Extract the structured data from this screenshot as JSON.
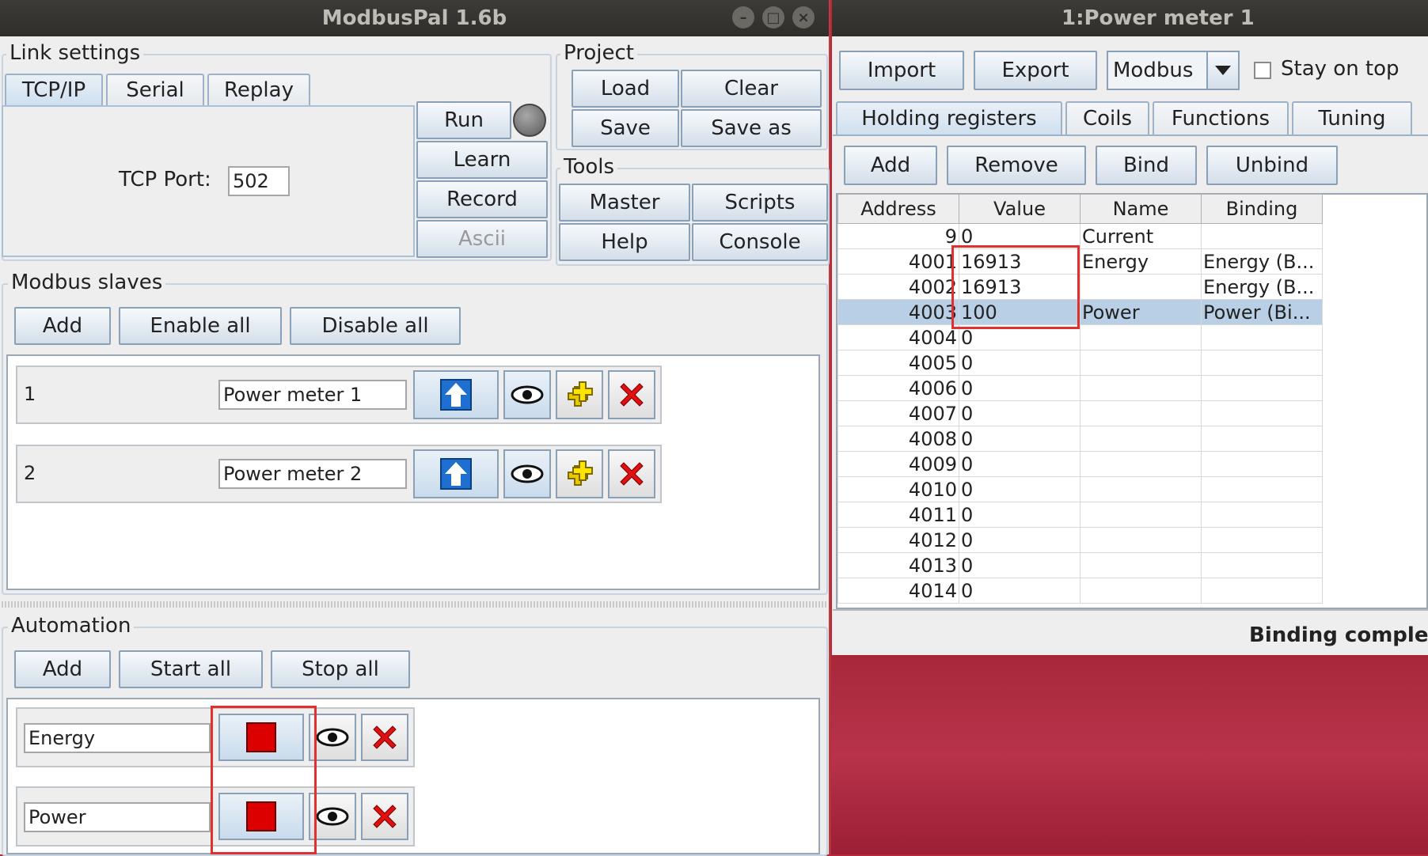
{
  "left_window": {
    "title": "ModbusPal 1.6b",
    "link_settings": {
      "title": "Link settings",
      "tabs": [
        "TCP/IP",
        "Serial",
        "Replay"
      ],
      "tcp_port_label": "TCP Port:",
      "tcp_port_value": "502",
      "buttons": {
        "run": "Run",
        "learn": "Learn",
        "record": "Record",
        "ascii": "Ascii"
      }
    },
    "project": {
      "title": "Project",
      "load": "Load",
      "clear": "Clear",
      "save": "Save",
      "save_as": "Save as"
    },
    "tools": {
      "title": "Tools",
      "master": "Master",
      "scripts": "Scripts",
      "help": "Help",
      "console": "Console"
    },
    "modbus_slaves": {
      "title": "Modbus slaves",
      "add": "Add",
      "enable_all": "Enable all",
      "disable_all": "Disable all",
      "items": [
        {
          "id": "1",
          "name": "Power meter 1"
        },
        {
          "id": "2",
          "name": "Power meter 2"
        }
      ]
    },
    "automation": {
      "title": "Automation",
      "add": "Add",
      "start_all": "Start all",
      "stop_all": "Stop all",
      "items": [
        {
          "name": "Energy"
        },
        {
          "name": "Power"
        }
      ]
    }
  },
  "right_window": {
    "title": "1:Power meter 1",
    "import": "Import",
    "export": "Export",
    "protocol_select": "Modbus",
    "stay_on_top": "Stay on top",
    "tabs": [
      "Holding registers",
      "Coils",
      "Functions",
      "Tuning"
    ],
    "actions": {
      "add": "Add",
      "remove": "Remove",
      "bind": "Bind",
      "unbind": "Unbind"
    },
    "table": {
      "columns": [
        "Address",
        "Value",
        "Name",
        "Binding"
      ],
      "rows": [
        [
          "9",
          "0",
          "Current",
          ""
        ],
        [
          "4001",
          "16913",
          "Energy",
          "Energy (B..."
        ],
        [
          "4002",
          "16913",
          "",
          "Energy (B..."
        ],
        [
          "4003",
          "100",
          "Power",
          "Power (Bi..."
        ],
        [
          "4004",
          "0",
          "",
          ""
        ],
        [
          "4005",
          "0",
          "",
          ""
        ],
        [
          "4006",
          "0",
          "",
          ""
        ],
        [
          "4007",
          "0",
          "",
          ""
        ],
        [
          "4008",
          "0",
          "",
          ""
        ],
        [
          "4009",
          "0",
          "",
          ""
        ],
        [
          "4010",
          "0",
          "",
          ""
        ],
        [
          "4011",
          "0",
          "",
          ""
        ],
        [
          "4012",
          "0",
          "",
          ""
        ],
        [
          "4013",
          "0",
          "",
          ""
        ],
        [
          "4014",
          "0",
          "",
          ""
        ]
      ]
    },
    "status": "Binding complet"
  },
  "colors": {
    "highlight_box": "#e03030",
    "selected_row": "#b8cfe5",
    "desktop": "#b7283d"
  }
}
